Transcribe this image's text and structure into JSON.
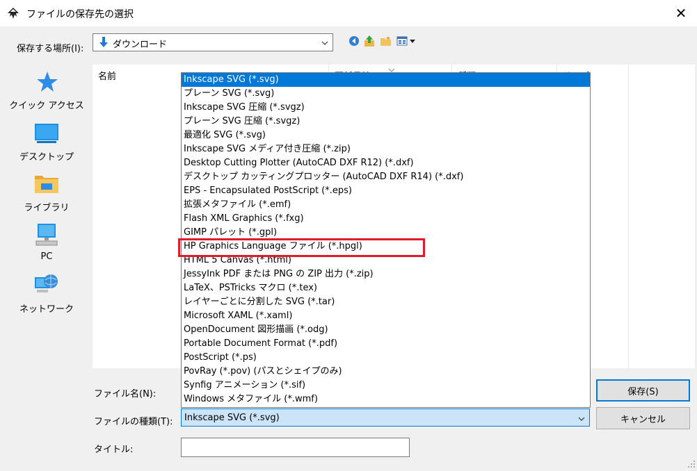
{
  "window": {
    "title": "ファイルの保存先の選択",
    "app_icon": "inkscape-icon",
    "close_glyph": "✕"
  },
  "save_in": {
    "label": "保存する場所(I):",
    "value": "ダウンロード",
    "icon": "download-arrow-icon"
  },
  "nav_icons": [
    "back-icon",
    "up-folder-icon",
    "new-folder-icon",
    "view-menu-icon"
  ],
  "places": [
    {
      "label": "クイック アクセス",
      "icon": "quick-access-star-icon"
    },
    {
      "label": "デスクトップ",
      "icon": "desktop-icon"
    },
    {
      "label": "ライブラリ",
      "icon": "library-icon"
    },
    {
      "label": "PC",
      "icon": "pc-icon"
    },
    {
      "label": "ネットワーク",
      "icon": "network-icon"
    }
  ],
  "columns": {
    "name": "名前",
    "date": "更新日時",
    "type": "種類",
    "size": "サイズ"
  },
  "filename": {
    "label": "ファイル名(N):"
  },
  "filetype": {
    "label": "ファイルの種類(T):",
    "value": "Inkscape SVG (*.svg)",
    "options": [
      "Inkscape SVG (*.svg)",
      "プレーン SVG (*.svg)",
      "Inkscape SVG 圧縮 (*.svgz)",
      "プレーン SVG 圧縮 (*.svgz)",
      "最適化 SVG (*.svg)",
      "Inkscape SVG メディア付き圧縮 (*.zip)",
      "Desktop Cutting Plotter (AutoCAD DXF R12) (*.dxf)",
      "デスクトップ カッティングプロッター (AutoCAD DXF R14) (*.dxf)",
      "EPS - Encapsulated PostScript (*.eps)",
      "拡張メタファイル (*.emf)",
      "Flash XML Graphics (*.fxg)",
      "GIMP パレット (*.gpl)",
      "HP Graphics Language ファイル (*.hpgl)",
      "HTML 5 Canvas (*.html)",
      "JessyInk PDF または PNG の ZIP 出力 (*.zip)",
      "LaTeX、PSTricks マクロ (*.tex)",
      "レイヤーごとに分割した SVG (*.tar)",
      "Microsoft XAML (*.xaml)",
      "OpenDocument 図形描画 (*.odg)",
      "Portable Document Format (*.pdf)",
      "PostScript (*.ps)",
      "PovRay (*.pov) (パスとシェイプのみ)",
      "Synfig アニメーション (*.sif)",
      "Windows メタファイル (*.wmf)"
    ],
    "selected_index": 0,
    "highlighted_index": 12
  },
  "title_field": {
    "label": "タイトル:"
  },
  "buttons": {
    "save": "保存(S)",
    "cancel": "キャンセル"
  },
  "colors": {
    "accent": "#0078d7",
    "highlight_box": "#e21b2b",
    "combo_selected_bg": "#cce4f7"
  }
}
